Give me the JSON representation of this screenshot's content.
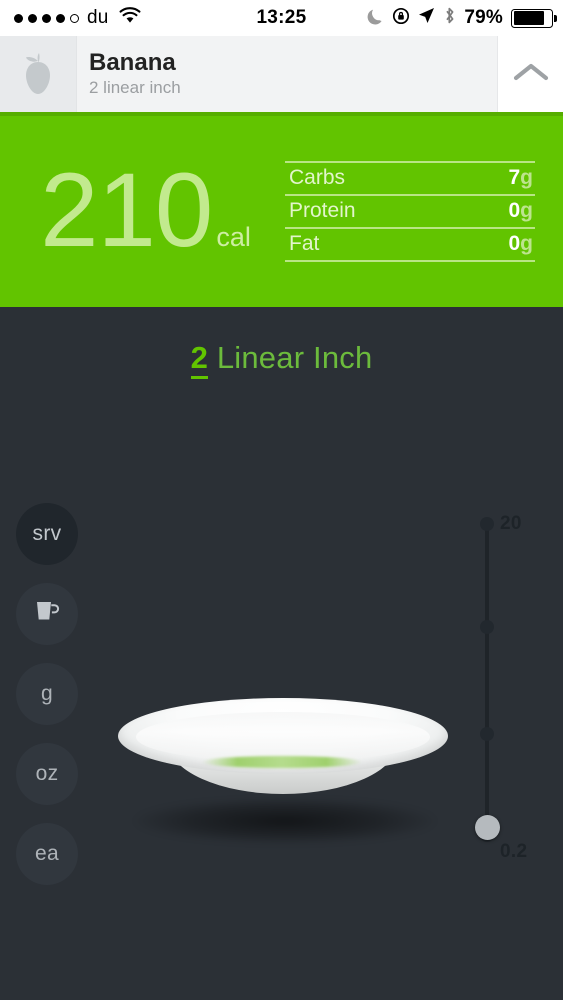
{
  "statusbar": {
    "signal_dots": 5,
    "signal_filled": 4,
    "carrier": "du",
    "wifi_icon": "wifi-icon",
    "time": "13:25",
    "moon_icon": "do-not-disturb-moon-icon",
    "rotation_lock_icon": "rotation-lock-icon",
    "location_icon": "location-arrow-icon",
    "bluetooth_icon": "bluetooth-icon",
    "battery_percent": "79%",
    "battery_icon": "battery-icon"
  },
  "header": {
    "food_icon": "apple-icon",
    "title": "Banana",
    "subtitle": "2 linear inch",
    "collapse_icon": "chevron-up-icon"
  },
  "calories": {
    "value": "210",
    "unit": "cal",
    "macros": [
      {
        "label": "Carbs",
        "value": "7",
        "unit": "g"
      },
      {
        "label": "Protein",
        "value": "0",
        "unit": "g"
      },
      {
        "label": "Fat",
        "value": "0",
        "unit": "g"
      }
    ]
  },
  "quantity": {
    "amount": "2",
    "unit_label": "Linear Inch"
  },
  "units": [
    {
      "id": "srv",
      "label": "srv",
      "icon": null,
      "selected": true
    },
    {
      "id": "cup",
      "label": "",
      "icon": "cup-icon",
      "selected": false
    },
    {
      "id": "g",
      "label": "g",
      "icon": null,
      "selected": false
    },
    {
      "id": "oz",
      "label": "oz",
      "icon": null,
      "selected": false
    },
    {
      "id": "ea",
      "label": "ea",
      "icon": null,
      "selected": false
    }
  ],
  "slider": {
    "max_label": "20",
    "min_label": "0.2",
    "handle_position_pct": 89
  },
  "plate": {
    "name": "portion-plate"
  },
  "colors": {
    "brand_green": "#62c400",
    "green_dark": "#56ad00",
    "pale_green": "#c2ea8e",
    "background": "#2b3036",
    "header_bg": "#f2f3f4"
  }
}
